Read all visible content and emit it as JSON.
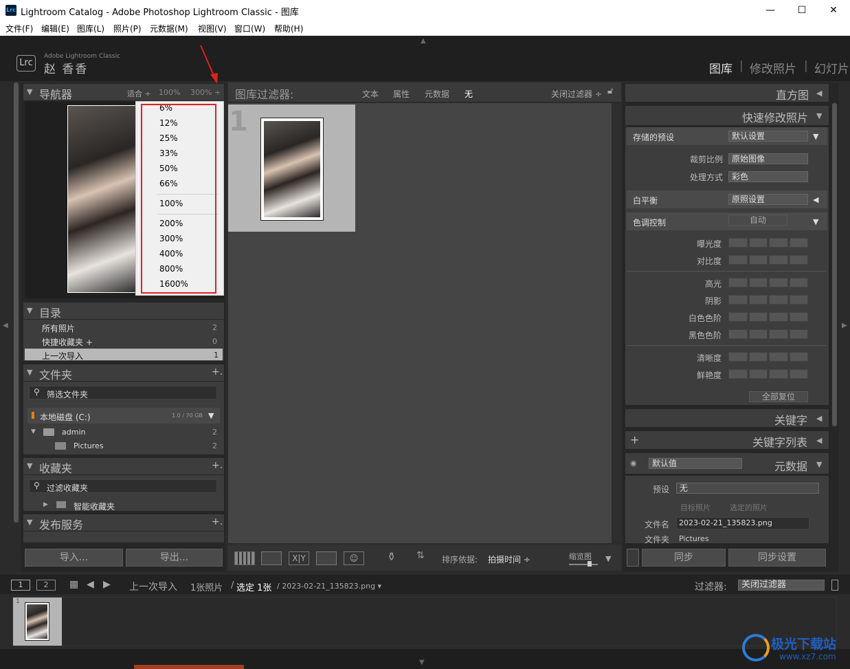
{
  "window": {
    "app_icon": "Lrc",
    "title": "Lightroom Catalog - Adobe Photoshop Lightroom Classic - 图库",
    "minimize": "—",
    "maximize": "☐",
    "close": "✕"
  },
  "menu": [
    "文件(F)",
    "编辑(E)",
    "图库(L)",
    "照片(P)",
    "元数据(M)",
    "视图(V)",
    "窗口(W)",
    "帮助(H)"
  ],
  "identity": {
    "logo": "Lrc",
    "product": "Adobe Lightroom Classic",
    "user": "赵 香香",
    "modules": [
      "图库",
      "修改照片",
      "幻灯片"
    ],
    "sep": "|"
  },
  "navigator": {
    "title": "导航器",
    "fit": "适合 ÷",
    "z100": "100%",
    "z300": "300% ÷"
  },
  "zoom_menu": {
    "group1": [
      "6%",
      "12%",
      "25%",
      "33%",
      "50%",
      "66%"
    ],
    "group2": [
      "100%"
    ],
    "group3": [
      "200%",
      "300%",
      "400%",
      "800%",
      "1600%"
    ]
  },
  "catalog": {
    "title": "目录",
    "rows": [
      {
        "label": "所有照片",
        "count": "2"
      },
      {
        "label": "快捷收藏夹 +",
        "count": "0"
      },
      {
        "label": "上一次导入",
        "count": "1"
      }
    ]
  },
  "folders": {
    "title": "文件夹",
    "plus": "+.",
    "filter": "筛选文件夹",
    "drive": "本地磁盘 (C:)",
    "drive_size": "1.0 / 70 GB",
    "items": [
      {
        "label": "admin",
        "count": "2"
      },
      {
        "label": "Pictures",
        "count": "2"
      }
    ]
  },
  "collections": {
    "title": "收藏夹",
    "plus": "+.",
    "filter": "过滤收藏夹",
    "smart": "智能收藏夹"
  },
  "publish": {
    "title": "发布服务",
    "plus": "+."
  },
  "left_buttons": {
    "import": "导入...",
    "export": "导出..."
  },
  "filter_bar": {
    "title": "图库过滤器:",
    "tabs": [
      "文本",
      "属性",
      "元数据",
      "无"
    ],
    "off": "关闭过滤器 ÷"
  },
  "grid": {
    "cell_number": "1"
  },
  "toolbar": {
    "sort_label": "排序依据:",
    "sort_value": "拍摄时间 ÷",
    "thumb_label": "缩览图",
    "xy": "X|Y"
  },
  "right": {
    "histogram": "直方图",
    "quick_develop": "快速修改照片",
    "saved_preset": {
      "label": "存储的预设",
      "value": "默认设置"
    },
    "crop": {
      "label": "裁剪比例",
      "value": "原始图像"
    },
    "treatment": {
      "label": "处理方式",
      "value": "彩色"
    },
    "wb": {
      "label": "白平衡",
      "value": "原照设置"
    },
    "tone": {
      "label": "色调控制",
      "auto": "自动"
    },
    "sliders": [
      "曝光度",
      "对比度",
      "高光",
      "阴影",
      "白色色阶",
      "黑色色阶",
      "清晰度",
      "鲜艳度"
    ],
    "reset_all": "全部复位",
    "keywords": "关键字",
    "keyword_list": "关键字列表",
    "metadata": {
      "title": "元数据",
      "default": "默认值",
      "preset_label": "预设",
      "preset_value": "无",
      "target": "目标照片",
      "selected": "选定的照片",
      "filename_label": "文件名",
      "filename": "2023-02-21_135823.png",
      "folder_label": "文件夹",
      "folder": "Pictures"
    },
    "sync": "同步",
    "sync_settings": "同步设置"
  },
  "filmstrip": {
    "screen1": "1",
    "screen2": "2",
    "source": "上一次导入",
    "count": "1张照片",
    "slash": "/",
    "selected": "选定 1张",
    "file": "/ 2023-02-21_135823.png ▾",
    "filter_label": "过滤器:",
    "filter_value": "关闭过滤器",
    "thumb_num": "1"
  },
  "watermark": {
    "cn": "极光下载站",
    "url": "www.xz7.com"
  },
  "colors": {
    "accent_red": "#e02020",
    "panel": "#3d3d3d",
    "background": "#2b2b2b"
  }
}
